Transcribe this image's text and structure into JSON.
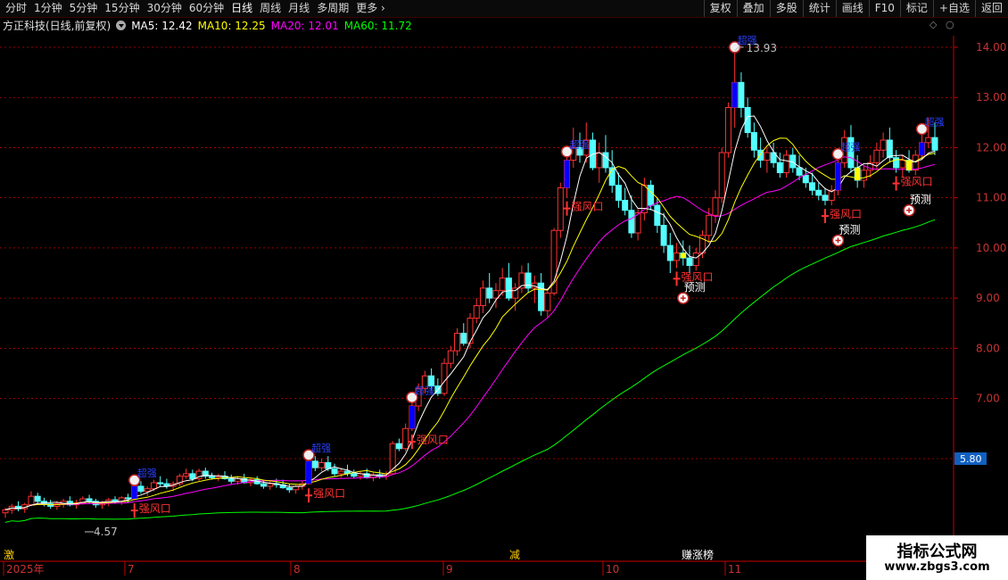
{
  "toolbar": {
    "periods": [
      "分时",
      "1分钟",
      "5分钟",
      "15分钟",
      "30分钟",
      "60分钟",
      "日线",
      "周线",
      "月线",
      "多周期",
      "更多"
    ],
    "active_period": "日线",
    "right_buttons": [
      "复权",
      "叠加",
      "多股",
      "统计",
      "画线",
      "F10",
      "标记",
      "+自选",
      "返回"
    ]
  },
  "info": {
    "title": "方正科技(日线,前复权)",
    "ma5": "MA5: 12.42",
    "ma10": "MA10: 12.25",
    "ma20": "MA20: 12.01",
    "ma60": "MA60: 11.72"
  },
  "colors": {
    "up": "#ff3232",
    "down": "#54ffff",
    "ma5": "#ffffff",
    "ma10": "#ffff00",
    "ma20": "#ff00ff",
    "ma60": "#00ff00",
    "axis": "#c80000",
    "grid": "#c80000",
    "signal_blue": "#0000ff",
    "signal_yellow": "#ffff00",
    "signal_text": "#ff3232"
  },
  "price_axis": {
    "ticks": [
      "14.00",
      "13.00",
      "12.00",
      "11.00",
      "10.00",
      "9.00",
      "8.00",
      "7.00",
      "5.80"
    ],
    "current": "5.80"
  },
  "date_axis": {
    "labels": [
      "2025年",
      "7",
      "8",
      "9",
      "10",
      "11"
    ]
  },
  "bottom_markers": [
    "激",
    "减",
    "赚",
    "涨榜"
  ],
  "chart_data": {
    "type": "candlestick",
    "high_label": "13.93",
    "low_label": "4.57",
    "ylim": [
      4.3,
      14.3
    ],
    "signals": {
      "strong": "强风口",
      "predict": "预测",
      "breakout": "超强"
    },
    "candles": [
      [
        4.72,
        4.82,
        4.62,
        4.78
      ],
      [
        4.78,
        4.9,
        4.7,
        4.85
      ],
      [
        4.85,
        4.95,
        4.75,
        4.8
      ],
      [
        4.8,
        4.92,
        4.72,
        4.88
      ],
      [
        4.88,
        5.15,
        4.85,
        5.05
      ],
      [
        5.05,
        5.12,
        4.9,
        4.95
      ],
      [
        4.95,
        5.02,
        4.85,
        4.9
      ],
      [
        4.9,
        4.98,
        4.8,
        4.85
      ],
      [
        4.85,
        4.95,
        4.78,
        4.9
      ],
      [
        4.9,
        5.0,
        4.82,
        4.95
      ],
      [
        4.95,
        5.05,
        4.85,
        4.88
      ],
      [
        4.88,
        4.98,
        4.8,
        4.92
      ],
      [
        4.92,
        5.05,
        4.88,
        5.0
      ],
      [
        5.0,
        5.08,
        4.9,
        4.95
      ],
      [
        4.95,
        5.0,
        4.82,
        4.88
      ],
      [
        4.88,
        4.96,
        4.8,
        4.92
      ],
      [
        4.92,
        5.02,
        4.85,
        4.98
      ],
      [
        4.98,
        5.05,
        4.9,
        4.95
      ],
      [
        4.95,
        5.05,
        4.88,
        5.02
      ],
      [
        5.02,
        5.1,
        4.92,
        5.0
      ],
      [
        5.0,
        5.3,
        4.98,
        5.25
      ],
      [
        5.25,
        5.35,
        5.1,
        5.15
      ],
      [
        5.15,
        5.25,
        5.05,
        5.2
      ],
      [
        5.2,
        5.38,
        5.15,
        5.32
      ],
      [
        5.32,
        5.45,
        5.25,
        5.3
      ],
      [
        5.3,
        5.4,
        5.2,
        5.25
      ],
      [
        5.25,
        5.35,
        5.15,
        5.3
      ],
      [
        5.3,
        5.5,
        5.25,
        5.45
      ],
      [
        5.45,
        5.6,
        5.4,
        5.5
      ],
      [
        5.5,
        5.58,
        5.35,
        5.4
      ],
      [
        5.4,
        5.6,
        5.35,
        5.55
      ],
      [
        5.55,
        5.62,
        5.4,
        5.45
      ],
      [
        5.45,
        5.52,
        5.38,
        5.42
      ],
      [
        5.42,
        5.5,
        5.35,
        5.45
      ],
      [
        5.45,
        5.55,
        5.38,
        5.4
      ],
      [
        5.4,
        5.48,
        5.3,
        5.35
      ],
      [
        5.35,
        5.45,
        5.28,
        5.4
      ],
      [
        5.4,
        5.5,
        5.3,
        5.32
      ],
      [
        5.32,
        5.42,
        5.25,
        5.38
      ],
      [
        5.38,
        5.45,
        5.28,
        5.3
      ],
      [
        5.3,
        5.38,
        5.2,
        5.25
      ],
      [
        5.25,
        5.35,
        5.18,
        5.3
      ],
      [
        5.3,
        5.4,
        5.22,
        5.28
      ],
      [
        5.28,
        5.38,
        5.2,
        5.22
      ],
      [
        5.22,
        5.3,
        5.12,
        5.18
      ],
      [
        5.18,
        5.28,
        5.1,
        5.25
      ],
      [
        5.25,
        5.35,
        5.18,
        5.3
      ],
      [
        5.3,
        5.8,
        5.28,
        5.75
      ],
      [
        5.75,
        5.85,
        5.55,
        5.62
      ],
      [
        5.62,
        5.8,
        5.55,
        5.72
      ],
      [
        5.72,
        5.85,
        5.55,
        5.6
      ],
      [
        5.6,
        5.7,
        5.45,
        5.5
      ],
      [
        5.5,
        5.62,
        5.42,
        5.55
      ],
      [
        5.55,
        5.68,
        5.45,
        5.5
      ],
      [
        5.5,
        5.58,
        5.4,
        5.45
      ],
      [
        5.45,
        5.55,
        5.38,
        5.5
      ],
      [
        5.5,
        5.6,
        5.4,
        5.42
      ],
      [
        5.42,
        5.52,
        5.35,
        5.48
      ],
      [
        5.48,
        5.58,
        5.4,
        5.45
      ],
      [
        5.45,
        5.55,
        5.38,
        5.5
      ],
      [
        5.5,
        6.15,
        5.48,
        6.1
      ],
      [
        6.1,
        6.2,
        5.95,
        6.0
      ],
      [
        6.0,
        6.5,
        5.95,
        6.4
      ],
      [
        6.4,
        6.95,
        6.35,
        6.85
      ],
      [
        6.85,
        7.3,
        6.75,
        7.2
      ],
      [
        7.2,
        7.55,
        7.1,
        7.45
      ],
      [
        7.45,
        7.6,
        7.15,
        7.25
      ],
      [
        7.25,
        7.4,
        7.05,
        7.1
      ],
      [
        7.1,
        7.8,
        7.05,
        7.7
      ],
      [
        7.7,
        8.05,
        7.6,
        7.95
      ],
      [
        7.95,
        8.4,
        7.85,
        8.3
      ],
      [
        8.3,
        8.5,
        8.05,
        8.1
      ],
      [
        8.1,
        8.7,
        8.0,
        8.6
      ],
      [
        8.6,
        9.0,
        8.5,
        8.85
      ],
      [
        8.85,
        9.35,
        8.7,
        9.2
      ],
      [
        9.2,
        9.5,
        8.9,
        9.0
      ],
      [
        9.0,
        9.3,
        8.8,
        9.15
      ],
      [
        9.15,
        9.6,
        9.05,
        9.4
      ],
      [
        9.4,
        9.7,
        8.95,
        9.0
      ],
      [
        9.0,
        9.3,
        8.75,
        9.2
      ],
      [
        9.2,
        9.65,
        9.1,
        9.5
      ],
      [
        9.5,
        9.7,
        9.1,
        9.2
      ],
      [
        9.2,
        9.45,
        8.9,
        9.3
      ],
      [
        9.3,
        9.5,
        8.65,
        8.75
      ],
      [
        8.75,
        9.2,
        8.6,
        9.1
      ],
      [
        9.1,
        10.4,
        9.05,
        10.35
      ],
      [
        10.35,
        11.3,
        10.2,
        11.2
      ],
      [
        11.2,
        11.85,
        11.0,
        11.75
      ],
      [
        11.75,
        12.4,
        11.6,
        12.0
      ],
      [
        12.0,
        12.3,
        11.7,
        11.85
      ],
      [
        11.85,
        12.5,
        11.7,
        12.15
      ],
      [
        12.15,
        12.3,
        11.55,
        11.6
      ],
      [
        11.6,
        12.1,
        11.3,
        11.9
      ],
      [
        11.9,
        12.25,
        11.5,
        11.6
      ],
      [
        11.6,
        11.95,
        11.1,
        11.25
      ],
      [
        11.25,
        11.5,
        10.8,
        10.95
      ],
      [
        10.95,
        11.2,
        10.65,
        10.75
      ],
      [
        10.75,
        11.05,
        10.2,
        10.3
      ],
      [
        10.3,
        10.8,
        10.15,
        10.7
      ],
      [
        10.7,
        11.4,
        10.55,
        11.25
      ],
      [
        11.25,
        11.35,
        10.75,
        10.85
      ],
      [
        10.85,
        11.0,
        10.3,
        10.45
      ],
      [
        10.45,
        10.7,
        9.9,
        10.05
      ],
      [
        10.05,
        10.3,
        9.5,
        9.75
      ],
      [
        9.75,
        10.1,
        9.6,
        9.9
      ],
      [
        9.9,
        10.15,
        9.65,
        9.8
      ],
      [
        9.8,
        10.05,
        9.5,
        9.65
      ],
      [
        9.65,
        10.0,
        9.55,
        9.9
      ],
      [
        9.9,
        10.35,
        9.8,
        10.25
      ],
      [
        10.25,
        10.8,
        10.1,
        10.65
      ],
      [
        10.65,
        11.15,
        10.5,
        11.0
      ],
      [
        11.0,
        12.0,
        10.9,
        11.9
      ],
      [
        11.9,
        12.9,
        11.8,
        12.8
      ],
      [
        12.8,
        13.93,
        12.4,
        13.3
      ],
      [
        13.3,
        13.5,
        12.6,
        12.8
      ],
      [
        12.8,
        13.0,
        12.2,
        12.3
      ],
      [
        12.3,
        12.5,
        11.8,
        11.95
      ],
      [
        11.95,
        12.2,
        11.6,
        11.75
      ],
      [
        11.75,
        12.0,
        11.5,
        11.9
      ],
      [
        11.9,
        12.1,
        11.6,
        11.7
      ],
      [
        11.7,
        11.9,
        11.4,
        11.5
      ],
      [
        11.5,
        11.95,
        11.4,
        11.85
      ],
      [
        11.85,
        12.0,
        11.5,
        11.6
      ],
      [
        11.6,
        11.85,
        11.35,
        11.45
      ],
      [
        11.45,
        11.6,
        11.2,
        11.3
      ],
      [
        11.3,
        11.5,
        11.05,
        11.15
      ],
      [
        11.15,
        11.3,
        10.95,
        11.05
      ],
      [
        11.05,
        11.2,
        10.85,
        10.95
      ],
      [
        10.95,
        11.25,
        10.85,
        11.15
      ],
      [
        11.15,
        11.8,
        11.05,
        11.7
      ],
      [
        11.7,
        12.35,
        11.6,
        12.2
      ],
      [
        12.2,
        12.45,
        11.5,
        11.6
      ],
      [
        11.6,
        11.85,
        11.2,
        11.35
      ],
      [
        11.35,
        11.65,
        11.2,
        11.55
      ],
      [
        11.55,
        11.85,
        11.4,
        11.7
      ],
      [
        11.7,
        12.1,
        11.55,
        11.95
      ],
      [
        11.95,
        12.3,
        11.8,
        12.15
      ],
      [
        12.15,
        12.4,
        11.7,
        11.8
      ],
      [
        11.8,
        11.95,
        11.5,
        11.6
      ],
      [
        11.6,
        11.85,
        11.4,
        11.75
      ],
      [
        11.75,
        11.95,
        11.5,
        11.55
      ],
      [
        11.55,
        11.95,
        11.45,
        11.85
      ],
      [
        11.85,
        12.3,
        11.75,
        12.1
      ],
      [
        12.1,
        12.6,
        12.0,
        12.2
      ],
      [
        12.2,
        12.5,
        11.85,
        11.95
      ]
    ]
  }
}
